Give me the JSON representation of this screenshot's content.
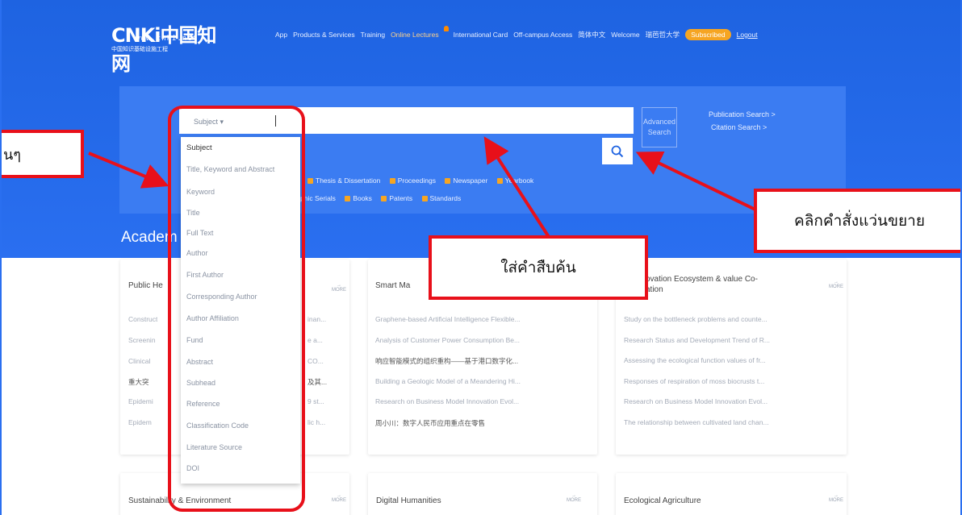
{
  "header": {
    "logo": {
      "mark": "CNKi中国知网",
      "url": "www.cnki.net",
      "subtitle": "中国知识基础设施工程"
    },
    "nav": [
      {
        "label": "App"
      },
      {
        "label": "Products & Services"
      },
      {
        "label": "Training"
      },
      {
        "label": "Online Lectures",
        "active": true
      },
      {
        "label": "International Card"
      },
      {
        "label": "Off-campus Access"
      },
      {
        "label": "简体中文"
      },
      {
        "label": "Welcome"
      },
      {
        "label": "瑞芭哲大学"
      },
      {
        "label": "Subscribed",
        "button": true
      },
      {
        "label": "Logout",
        "link": true
      }
    ]
  },
  "search": {
    "field_selector": "Subject ▾",
    "advanced_button": [
      "Advanced",
      "Search"
    ],
    "publication_search": "Publication Search >",
    "citation_search": "Citation Search >",
    "types_row1": [
      "Thesis & Dissertation",
      "Proceedings",
      "Newspaper",
      "Yearbook"
    ],
    "types_row1_head": "",
    "types_row2": [
      "phic Serials",
      "Books",
      "Patents",
      "Standards"
    ],
    "search_icon": "magnifier-icon"
  },
  "dropdown": {
    "items": [
      "Subject",
      "Title, Keyword and Abstract",
      "Keyword",
      "Title",
      "Full Text",
      "Author",
      "First Author",
      "Corresponding Author",
      "Author Affiliation",
      "Fund",
      "Abstract",
      "Subhead",
      "Reference",
      "Classification Code",
      "Literature Source",
      "DOI"
    ]
  },
  "section_title": "Academ",
  "more_label": [
    "→",
    "MORE"
  ],
  "cards": [
    {
      "title": "Public He",
      "lines": [
        "Construct",
        "Screenin",
        "Clinical",
        "重大突",
        "Epidemi",
        "Epidem"
      ],
      "right_lines": [
        "inan...",
        "e a...",
        "CO...",
        "及其...",
        "9 st...",
        "lic h..."
      ]
    },
    {
      "title": "Smart Ma",
      "lines": [
        "Graphene-based Artificial Intelligence Flexible...",
        "Analysis of Customer Power Consumption Be...",
        "响应智能模式的组织重构——基于港口数字化...",
        "Building a Geologic Model of a Meandering Hi...",
        "Research on Business Model Innovation Evol...",
        "周小川：数字人民币应用重点在零售"
      ]
    },
    {
      "title_line1": "ovation Ecosystem & value Co-",
      "title_line2": "ation",
      "lines": [
        "Study on the bottleneck problems and counte...",
        "Research Status and Development Trend of R...",
        "Assessing the ecological function values of fr...",
        "Responses of respiration of moss biocrusts t...",
        "Research on Business Model Innovation Evol...",
        "The relationship between cultivated land chan..."
      ]
    }
  ],
  "bottom_cards": [
    {
      "title": "Sustainability & Environment"
    },
    {
      "title": "Digital Humanities"
    },
    {
      "title": "Ecological Agriculture"
    }
  ],
  "annotations": {
    "left_callout": "นๆ",
    "center_callout": "ใส่คำสืบค้น",
    "right_callout": "คลิกคำสั่งแว่นขยาย",
    "accent_color": "#e8101a"
  },
  "colors": {
    "brand_blue": "#2a6ff0",
    "search_panel": "#3b7cf2",
    "accent_orange": "#f6a522"
  }
}
